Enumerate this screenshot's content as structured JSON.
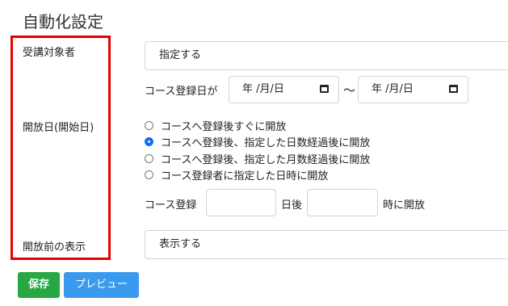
{
  "page": {
    "title": "自動化設定"
  },
  "labels": {
    "target": "受講対象者",
    "start_date": "開放日(開始日)",
    "pre_display": "開放前の表示"
  },
  "target_select": {
    "value": "指定する"
  },
  "date_range": {
    "prefix": "コース登録日が",
    "from_placeholder": "年 /月/日",
    "separator": "〜",
    "to_placeholder": "年 /月/日"
  },
  "open_options": [
    {
      "label": "コースへ登録後すぐに開放",
      "checked": false
    },
    {
      "label": "コースへ登録後、指定した日数経過後に開放",
      "checked": true
    },
    {
      "label": "コースへ登録後、指定した月数経過後に開放",
      "checked": false
    },
    {
      "label": "コース登録者に指定した日時に開放",
      "checked": false
    }
  ],
  "days_row": {
    "prefix": "コース登録",
    "middle": "日後",
    "suffix": "時に開放"
  },
  "pre_display_select": {
    "value": "表示する"
  },
  "buttons": {
    "save": "保存",
    "preview": "プレビュー"
  },
  "colors": {
    "highlight": "#e60000",
    "save": "#28a745",
    "preview": "#3a9af0",
    "radio_checked": "#0d6efd"
  }
}
